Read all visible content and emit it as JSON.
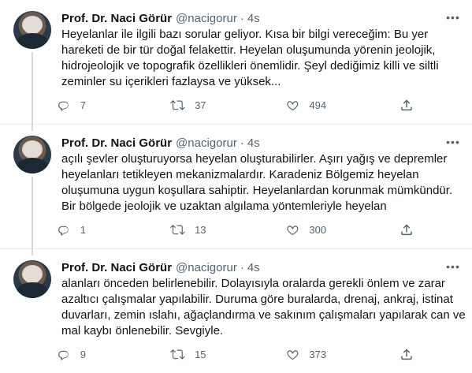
{
  "tweets": [
    {
      "name": "Prof. Dr. Naci Görür",
      "handle": "@nacigorur",
      "sep": "·",
      "time": "4s",
      "lines": [
        "Heyelanlar ile ilgili bazı sorular geliyor. Kısa bir bilgi vereceğim: Bu yer",
        "hareketi de bir tür doğal felakettir. Heyelan oluşumunda yörenin jeolojik,",
        "hidrojeolojik ve topografik özellikleri önemlidir. Şeyl dediğimiz killi ve siltli",
        "zeminler su içerikleri fazlaysa ve yüksek..."
      ],
      "replies": "7",
      "retweets": "37",
      "likes": "494"
    },
    {
      "name": "Prof. Dr. Naci Görür",
      "handle": "@nacigorur",
      "sep": "·",
      "time": "4s",
      "lines": [
        "açılı şevler oluşturuyorsa heyelan oluşturabilirler. Aşırı yağış ve depremler",
        "heyelanları tetikleyen mekanizmalardır. Karadeniz Bölgemiz heyelan",
        "oluşumuna uygun koşullara sahiptir. Heyelanlardan korunmak mümkündür.",
        "Bir bölgede jeolojik ve uzaktan algılama yöntemleriyle heyelan"
      ],
      "replies": "1",
      "retweets": "13",
      "likes": "300"
    },
    {
      "name": "Prof. Dr. Naci Görür",
      "handle": "@nacigorur",
      "sep": "·",
      "time": "4s",
      "lines": [
        "alanları önceden belirlenebilir. Dolayısıyla oralarda gerekli önlem ve zarar",
        "azaltıcı çalışmalar yapılabilir. Duruma göre buralarda, drenaj, ankraj, istinat",
        "duvarları, zemin ıslahı, ağaçlandırma ve sakınım çalışmaları yapılarak can ve",
        "mal kaybı önlenebilir. Sevgiyle."
      ],
      "replies": "9",
      "retweets": "15",
      "likes": "373"
    }
  ],
  "icons": {
    "reply": "reply-icon",
    "retweet": "retweet-icon",
    "like": "heart-icon",
    "share": "share-icon",
    "more": "more-icon"
  },
  "colors": {
    "text": "#0f1419",
    "secondary": "#536471",
    "divider": "#e6ecf0"
  }
}
